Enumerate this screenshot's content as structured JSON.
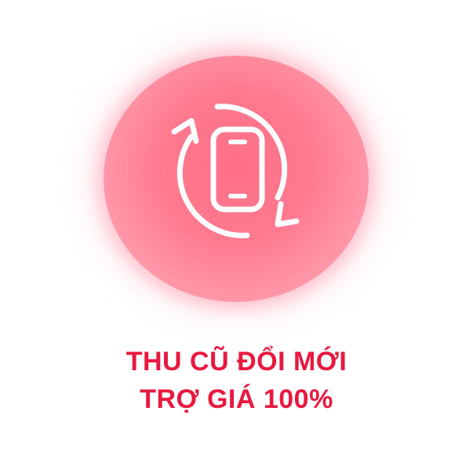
{
  "promo": {
    "icon": "phone-exchange-icon",
    "line1": "THU CŨ ĐỔI MỚI",
    "line2": "TRỢ GIÁ 100%"
  },
  "colors": {
    "title_red": "#e8183f",
    "badge_pink": "#ff7a8f",
    "icon_white": "#ffffff"
  }
}
